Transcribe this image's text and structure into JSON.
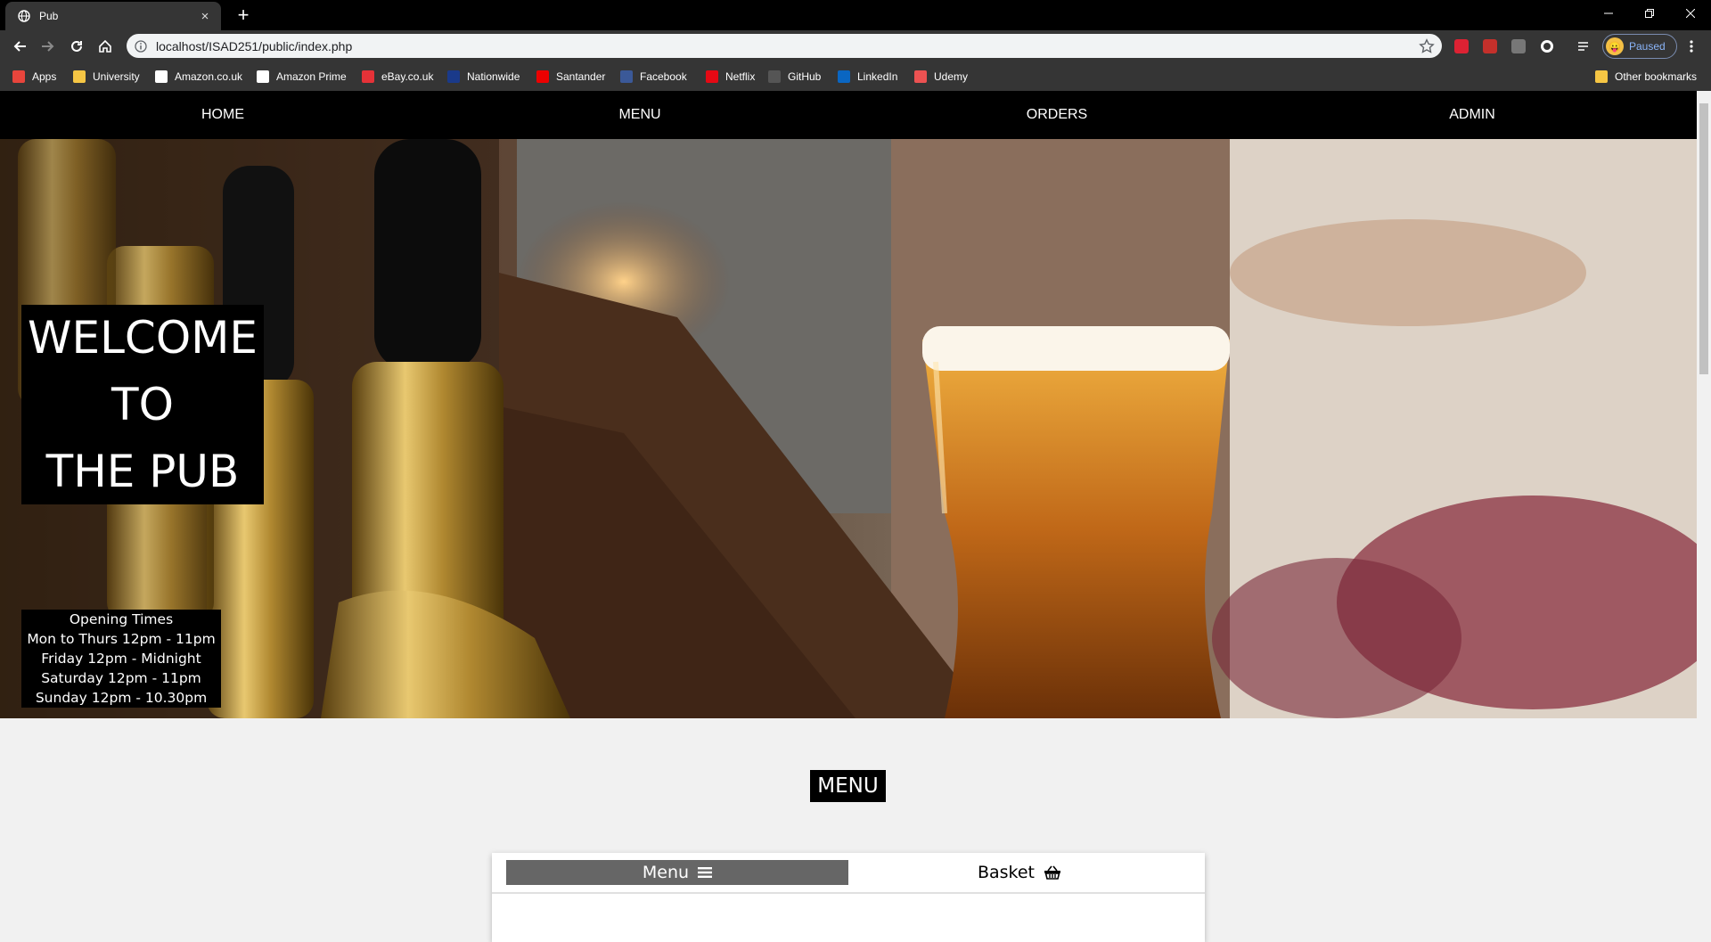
{
  "browser": {
    "tab_title": "Pub",
    "tab_close": "×",
    "new_tab": "+",
    "url": "localhost/ISAD251/public/index.php",
    "profile_label": "Paused",
    "window_controls": [
      "minimize-icon",
      "restore-icon",
      "close-icon"
    ]
  },
  "bookmarks": [
    {
      "label": "Apps",
      "icon": "apps-grid-icon",
      "color": "#e8453c"
    },
    {
      "label": "University",
      "icon": "folder-icon",
      "color": "#f6c644"
    },
    {
      "label": "Amazon.co.uk",
      "icon": "amazon-icon",
      "color": "#ffffff"
    },
    {
      "label": "Amazon Prime",
      "icon": "amazon-icon",
      "color": "#ffffff"
    },
    {
      "label": "eBay.co.uk",
      "icon": "ebay-icon",
      "color": "#e53238"
    },
    {
      "label": "Nationwide",
      "icon": "nationwide-icon",
      "color": "#1a3a8a"
    },
    {
      "label": "Santander",
      "icon": "santander-icon",
      "color": "#ec0000"
    },
    {
      "label": "Facebook",
      "icon": "facebook-icon",
      "color": "#3b5998"
    },
    {
      "label": "Netflix",
      "icon": "netflix-icon",
      "color": "#e50914"
    },
    {
      "label": "GitHub",
      "icon": "github-icon",
      "color": "#555555"
    },
    {
      "label": "LinkedIn",
      "icon": "linkedin-icon",
      "color": "#0a66c2"
    },
    {
      "label": "Udemy",
      "icon": "udemy-icon",
      "color": "#ec5252"
    },
    {
      "label": "Other bookmarks",
      "icon": "folder-icon",
      "color": "#f6c644"
    }
  ],
  "nav": {
    "items": [
      "HOME",
      "MENU",
      "ORDERS",
      "ADMIN"
    ]
  },
  "hero": {
    "welcome_lines": [
      "WELCOME",
      "TO",
      "THE PUB"
    ],
    "hours_lines": [
      "Opening Times",
      "Mon to Thurs 12pm - 11pm",
      "Friday 12pm - Midnight",
      "Saturday 12pm - 11pm",
      "Sunday 12pm - 10.30pm"
    ]
  },
  "content": {
    "menu_heading": "MENU",
    "tabs": [
      {
        "label": "Menu",
        "icon": "hamburger-icon"
      },
      {
        "label": "Basket",
        "icon": "basket-icon"
      }
    ]
  }
}
